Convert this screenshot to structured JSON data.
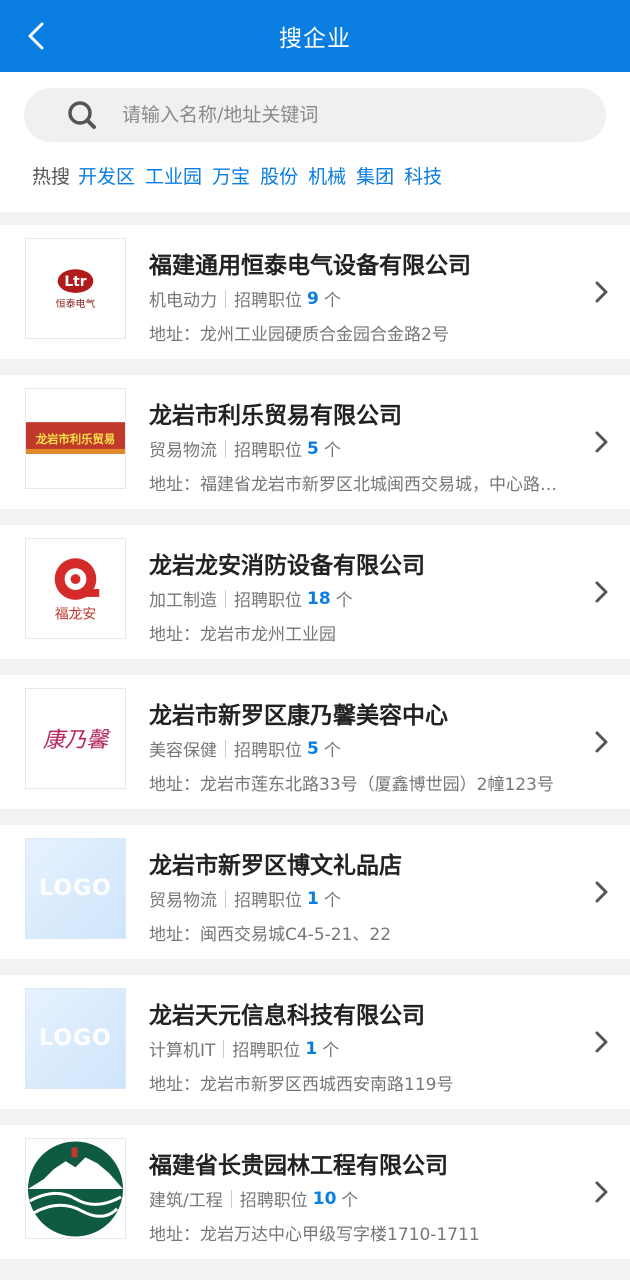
{
  "header": {
    "title": "搜企业"
  },
  "search": {
    "placeholder": "请输入名称/地址关键词"
  },
  "hot": {
    "label": "热搜",
    "tags": [
      "开发区",
      "工业园",
      "万宝",
      "股份",
      "机械",
      "集团",
      "科技"
    ]
  },
  "common": {
    "jobs_label": "招聘职位",
    "unit": "个",
    "address_prefix": "地址："
  },
  "companies": [
    {
      "name": "福建通用恒泰电气设备有限公司",
      "category": "机电动力",
      "jobs": "9",
      "address": "龙州工业园硬质合金园合金路2号",
      "logo_text": "恒泰电气"
    },
    {
      "name": "龙岩市利乐贸易有限公司",
      "category": "贸易物流",
      "jobs": "5",
      "address": "福建省龙岩市新罗区北城闽西交易城，中心路…",
      "logo_text": "龙岩市利乐贸易"
    },
    {
      "name": "龙岩龙安消防设备有限公司",
      "category": "加工制造",
      "jobs": "18",
      "address": "龙岩市龙州工业园",
      "logo_text": "福龙安"
    },
    {
      "name": "龙岩市新罗区康乃馨美容中心",
      "category": "美容保健",
      "jobs": "5",
      "address": "龙岩市莲东北路33号（厦鑫博世园）2幢123号",
      "logo_text": "康乃馨"
    },
    {
      "name": "龙岩市新罗区博文礼品店",
      "category": "贸易物流",
      "jobs": "1",
      "address": "闽西交易城C4-5-21、22",
      "logo_text": "LOGO"
    },
    {
      "name": "龙岩天元信息科技有限公司",
      "category": "计算机IT",
      "jobs": "1",
      "address": "龙岩市新罗区西城西安南路119号",
      "logo_text": "LOGO"
    },
    {
      "name": "福建省长贵园林工程有限公司",
      "category": "建筑/工程",
      "jobs": "10",
      "address": "龙岩万达中心甲级写字楼1710-1711",
      "logo_text": ""
    }
  ],
  "colors": {
    "brand": "#0a7ee0",
    "background": "#f2f2f2"
  }
}
